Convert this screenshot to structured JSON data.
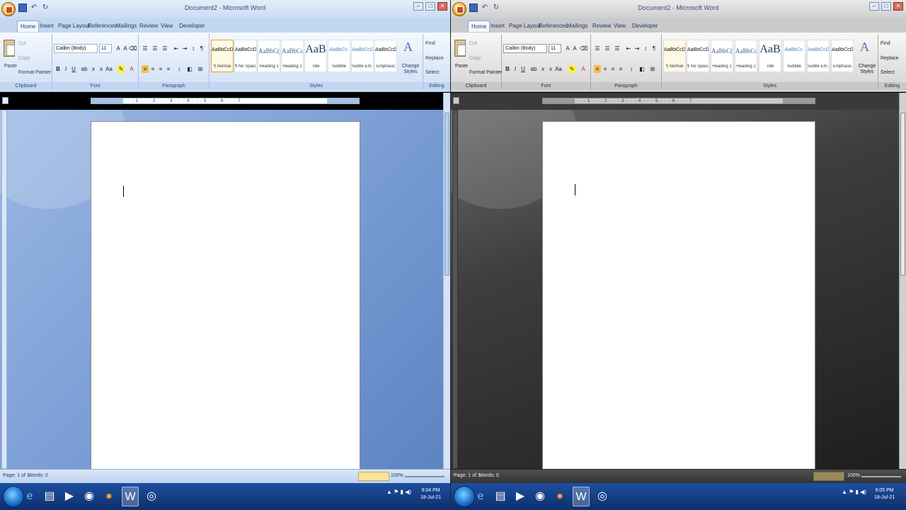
{
  "window": {
    "title": "Document2 - Microsoft Word"
  },
  "tabs": [
    "Home",
    "Insert",
    "Page Layout",
    "References",
    "Mailings",
    "Review",
    "View",
    "Developer"
  ],
  "clipboard": {
    "paste": "Paste",
    "cut": "Cut",
    "copy": "Copy",
    "format_painter": "Format Painter",
    "label": "Clipboard"
  },
  "font": {
    "name": "Calibri (Body)",
    "size": "11",
    "label": "Font"
  },
  "paragraph": {
    "label": "Paragraph"
  },
  "styles": {
    "label": "Styles",
    "items": [
      {
        "preview": "AaBbCcDc",
        "name": "¶ Normal"
      },
      {
        "preview": "AaBbCcDc",
        "name": "¶ No Spaci..."
      },
      {
        "preview": "AaBbC(",
        "name": "Heading 1"
      },
      {
        "preview": "AaBbCc",
        "name": "Heading 2"
      },
      {
        "preview": "AaB",
        "name": "Title"
      },
      {
        "preview": "AaBbCc.",
        "name": "Subtitle"
      },
      {
        "preview": "AaBbCcDc",
        "name": "Subtle Em..."
      },
      {
        "preview": "AaBbCcDc",
        "name": "Emphasis"
      }
    ],
    "change_styles": "Change Styles"
  },
  "editing": {
    "find": "Find",
    "replace": "Replace",
    "select": "Select",
    "label": "Editing"
  },
  "ruler": {
    "marks": "· · · 1 · · · 2 · · · 3 · · · 4 · · · 5 · · · 6 · · · 7"
  },
  "status": {
    "page": "Page: 1 of 1",
    "words": "Words: 0",
    "zoom": "100%"
  },
  "taskbar": {
    "left_time": "9:04 PM",
    "left_date": "18-Jul-21",
    "right_time": "9:05 PM",
    "right_date": "18-Jul-21"
  },
  "theme": {
    "blue_accent": "#c4d7f1",
    "black_accent": "#333333"
  }
}
